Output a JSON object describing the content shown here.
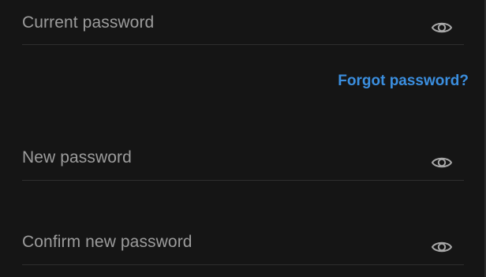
{
  "form": {
    "current_password": {
      "placeholder": "Current password",
      "icon": "eye-icon"
    },
    "forgot_password_link": "Forgot password?",
    "new_password": {
      "placeholder": "New password",
      "icon": "eye-icon"
    },
    "confirm_password": {
      "placeholder": "Confirm new password",
      "icon": "eye-icon"
    }
  },
  "colors": {
    "background": "#151515",
    "placeholder_text": "#9c9c9c",
    "divider": "#2e2e2e",
    "link": "#3b8fe0",
    "icon": "#a8a8a8"
  }
}
